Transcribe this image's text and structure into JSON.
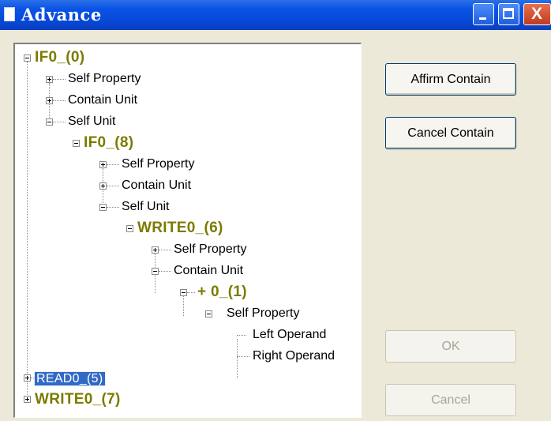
{
  "window": {
    "title": "Advance",
    "controls": {
      "minimize": "minimize",
      "maximize": "maximize",
      "close": "X"
    }
  },
  "tree": {
    "if0_0": "IF0_(0)",
    "if0_0_self_property": "Self Property",
    "if0_0_contain_unit": "Contain Unit",
    "if0_0_self_unit": "Self Unit",
    "if0_8": "IF0_(8)",
    "if0_8_self_property": "Self Property",
    "if0_8_contain_unit": "Contain Unit",
    "if0_8_self_unit": "Self Unit",
    "write0_6": "WRITE0_(6)",
    "write0_6_self_property": "Self Property",
    "write0_6_contain_unit": "Contain Unit",
    "plus0_1": "+ 0_(1)",
    "plus0_1_self_property": "Self Property",
    "left_operand": "Left Operand",
    "right_operand": "Right Operand",
    "read0_5": "READ0_(5)",
    "write0_7": "WRITE0_(7)"
  },
  "buttons": {
    "affirm_contain": "Affirm Contain",
    "cancel_contain": "Cancel Contain",
    "ok": "OK",
    "cancel": "Cancel"
  },
  "colors": {
    "titlebar": "#0a53e6",
    "unit_text": "#7b7b00",
    "selection": "#316ac5",
    "dialog_bg": "#ece9d8"
  }
}
